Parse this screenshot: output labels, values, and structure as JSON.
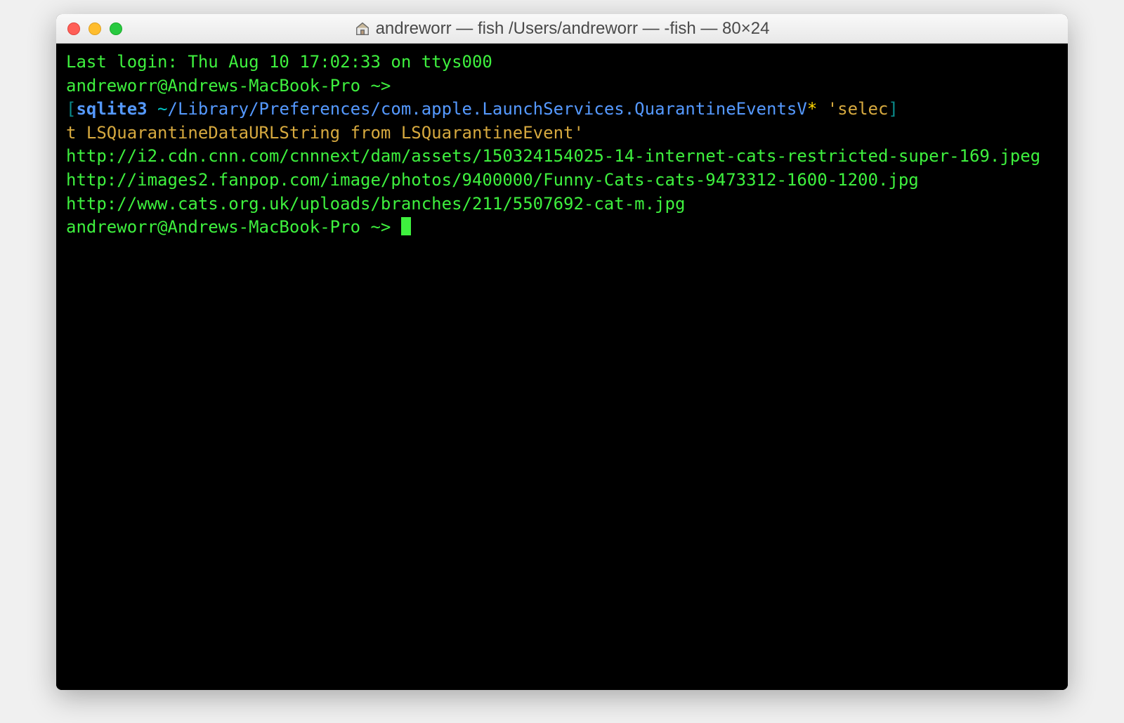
{
  "titlebar": {
    "title": "andreworr — fish  /Users/andreworr — -fish — 80×24",
    "home_icon": "⌂"
  },
  "terminal": {
    "last_login": "Last login: Thu Aug 10 17:02:33 on ttys000",
    "prompt1": "andreworr@Andrews-MacBook-Pro ~>",
    "bracket_open": "[",
    "bracket_close": "]",
    "cmd_sqlite": "sqlite3 ",
    "cmd_path_tilde": "~",
    "cmd_path_rest": "/Library/Preferences/com.apple.LaunchServices.QuarantineEventsV",
    "cmd_star": "*",
    "cmd_sql_part1": " 'selec",
    "cmd_sql_part2": "t LSQuarantineDataURLString from LSQuarantineEvent'",
    "output1": "http://i2.cdn.cnn.com/cnnnext/dam/assets/150324154025-14-internet-cats-restricted-super-169.jpeg",
    "output2": "http://images2.fanpop.com/image/photos/9400000/Funny-Cats-cats-9473312-1600-1200.jpg",
    "output3": "http://www.cats.org.uk/uploads/branches/211/5507692-cat-m.jpg",
    "prompt2": "andreworr@Andrews-MacBook-Pro ~> "
  },
  "colors": {
    "terminal_bg": "#000000",
    "green": "#3ef03e",
    "blue": "#5599ff",
    "yellow": "#d6a93f",
    "cyan": "#00c8c8"
  }
}
